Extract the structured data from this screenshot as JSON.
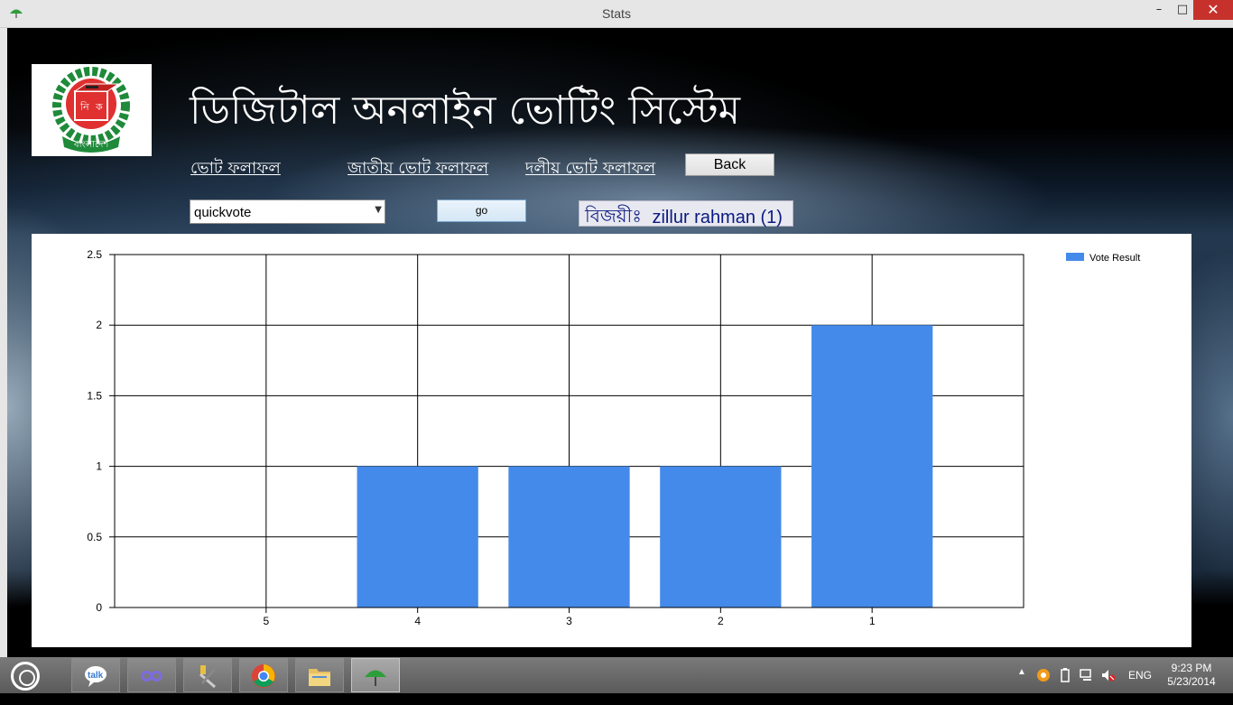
{
  "window": {
    "title": "Stats",
    "minimize_glyph": "–",
    "maximize_glyph": "□",
    "close_glyph": "✕"
  },
  "header": {
    "app_title": "ডিজিটাল অনলাইন ভোটিং সিস্টেম",
    "logo": {
      "letters": [
        "নি",
        "ক"
      ],
      "caption": "বাংলাদেশ"
    }
  },
  "nav": {
    "links": [
      "ভোট ফলাফল",
      "জাতীয় ভোট ফলাফল",
      "দলীয় ভোট ফলাফল"
    ],
    "back_label": "Back"
  },
  "controls": {
    "vote_select_value": "quickvote",
    "go_label": "go",
    "winner_label": "বিজয়ীঃ",
    "winner_name": "zillur rahman (1)"
  },
  "chart_data": {
    "type": "bar",
    "categories": [
      "5",
      "4",
      "3",
      "2",
      "1"
    ],
    "series": [
      {
        "name": "Vote Result",
        "values": [
          0,
          1,
          1,
          1,
          2
        ],
        "color": "#448aea"
      }
    ],
    "ylim": [
      0,
      2.5
    ],
    "yticks": [
      0,
      0.5,
      1,
      1.5,
      2,
      2.5
    ],
    "ytick_labels": [
      "0",
      "0.5",
      "1",
      "1.5",
      "2",
      "2.5"
    ],
    "grid": true,
    "legend": "top-right"
  },
  "taskbar": {
    "apps": [
      "talk-app",
      "infinity-app",
      "tools-app",
      "chrome-app",
      "file-explorer-app",
      "voting-app"
    ],
    "language": "ENG",
    "time": "9:23 PM",
    "date": "5/23/2014"
  }
}
